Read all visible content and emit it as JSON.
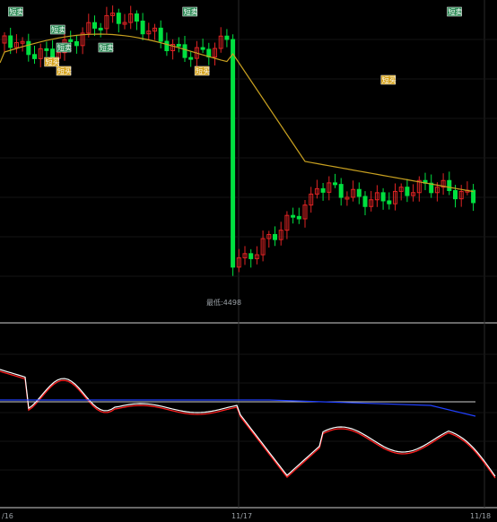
{
  "chart_data": {
    "type": "candlestick",
    "x_axis_labels": [
      "/16",
      "11/17",
      "11/18"
    ],
    "low_annotation": "最低:4498",
    "signals": [
      {
        "label": "短卖",
        "type": "sell",
        "index": 2
      },
      {
        "label": "短卖",
        "type": "sell",
        "index": 9
      },
      {
        "label": "短卖",
        "type": "sell",
        "index": 10
      },
      {
        "label": "短买",
        "type": "buy",
        "index": 8
      },
      {
        "label": "短买",
        "type": "buy",
        "index": 10
      },
      {
        "label": "短卖",
        "type": "sell",
        "index": 17
      },
      {
        "label": "短卖",
        "type": "sell",
        "index": 31
      },
      {
        "label": "短买",
        "type": "buy",
        "index": 33
      },
      {
        "label": "短买",
        "type": "buy",
        "index": 64
      },
      {
        "label": "短卖",
        "type": "sell",
        "index": 75
      }
    ],
    "colors": {
      "up": "#e02424",
      "down": "#00e040",
      "ma": "#c8a020",
      "osc_white": "#ffffff",
      "osc_red": "#ff2020",
      "osc_blue": "#2040ff",
      "grid": "#333333"
    }
  }
}
